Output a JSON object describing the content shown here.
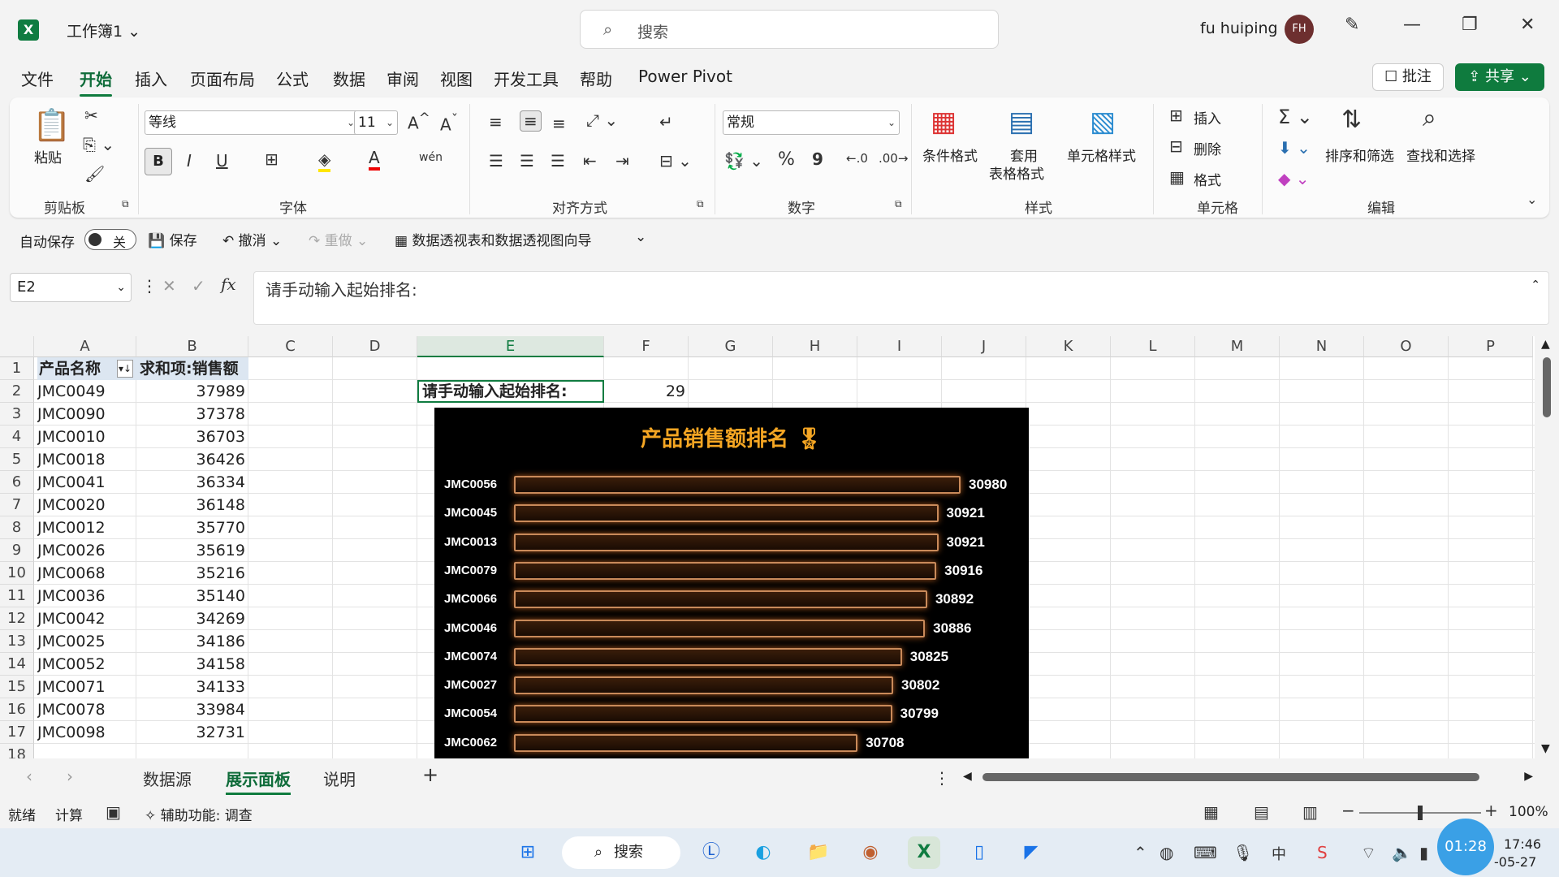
{
  "titlebar": {
    "workbook": "工作簿1",
    "search_placeholder": "搜索",
    "user": "fu huiping",
    "avatar": "FH"
  },
  "menu": [
    "文件",
    "开始",
    "插入",
    "页面布局",
    "公式",
    "数据",
    "审阅",
    "视图",
    "开发工具",
    "帮助",
    "Power Pivot"
  ],
  "menu_active": "开始",
  "comment_label": "批注",
  "share_label": "共享",
  "ribbon": {
    "clipboard": {
      "paste": "粘贴",
      "group": "剪贴板"
    },
    "font": {
      "name": "等线",
      "size": "11",
      "group": "字体",
      "bold": "B",
      "italic": "I",
      "underline": "U"
    },
    "align": {
      "group": "对齐方式"
    },
    "number": {
      "format": "常规",
      "group": "数字",
      "percent": "%",
      "comma": "9"
    },
    "styles": {
      "cond": "条件格式",
      "table1": "套用",
      "table2": "表格格式",
      "cell": "单元格样式",
      "group": "样式"
    },
    "cells": {
      "insert": "插入",
      "delete": "删除",
      "format": "格式",
      "group": "单元格"
    },
    "edit": {
      "sort": "排序和筛选",
      "find": "查找和选择",
      "group": "编辑"
    }
  },
  "qat": {
    "autosave": "自动保存",
    "toggle": "关",
    "save": "保存",
    "undo": "撤消",
    "redo": "重做",
    "pivot": "数据透视表和数据透视图向导"
  },
  "namebox": "E2",
  "formula": "请手动输入起始排名:",
  "columns": [
    "A",
    "B",
    "C",
    "D",
    "E",
    "F",
    "G",
    "H",
    "I",
    "J",
    "K",
    "L",
    "M",
    "N",
    "O",
    "P"
  ],
  "header_row": {
    "a": "产品名称",
    "b": "求和项:销售额"
  },
  "rows": [
    {
      "r": "2",
      "a": "JMC0049",
      "b": "37989"
    },
    {
      "r": "3",
      "a": "JMC0090",
      "b": "37378"
    },
    {
      "r": "4",
      "a": "JMC0010",
      "b": "36703"
    },
    {
      "r": "5",
      "a": "JMC0018",
      "b": "36426"
    },
    {
      "r": "6",
      "a": "JMC0041",
      "b": "36334"
    },
    {
      "r": "7",
      "a": "JMC0020",
      "b": "36148"
    },
    {
      "r": "8",
      "a": "JMC0012",
      "b": "35770"
    },
    {
      "r": "9",
      "a": "JMC0026",
      "b": "35619"
    },
    {
      "r": "10",
      "a": "JMC0068",
      "b": "35216"
    },
    {
      "r": "11",
      "a": "JMC0036",
      "b": "35140"
    },
    {
      "r": "12",
      "a": "JMC0042",
      "b": "34269"
    },
    {
      "r": "13",
      "a": "JMC0025",
      "b": "34186"
    },
    {
      "r": "14",
      "a": "JMC0052",
      "b": "34158"
    },
    {
      "r": "15",
      "a": "JMC0071",
      "b": "34133"
    },
    {
      "r": "16",
      "a": "JMC0078",
      "b": "33984"
    },
    {
      "r": "17",
      "a": "JMC0098",
      "b": "32731"
    }
  ],
  "e2_label": "请手动输入起始排名:",
  "f2_value": "29",
  "chart_data": {
    "type": "bar",
    "title": "产品销售额排名",
    "categories": [
      "JMC0056",
      "JMC0045",
      "JMC0013",
      "JMC0079",
      "JMC0066",
      "JMC0046",
      "JMC0074",
      "JMC0027",
      "JMC0054",
      "JMC0062"
    ],
    "values": [
      30980,
      30921,
      30921,
      30916,
      30892,
      30886,
      30825,
      30802,
      30799,
      30708
    ],
    "xlim": [
      29800,
      30980
    ],
    "orientation": "horizontal",
    "colors": {
      "background": "#000000",
      "bar": "#c98a5a",
      "title": "#f5a623"
    }
  },
  "sheets": [
    "数据源",
    "展示面板",
    "说明"
  ],
  "sheet_active": "展示面板",
  "status": {
    "ready": "就绪",
    "calc": "计算",
    "accessibility": "辅助功能: 调查",
    "zoom": "100%"
  },
  "taskbar": {
    "search": "搜索",
    "timer": "01:28",
    "time": "17:46",
    "date": "-05-27"
  }
}
